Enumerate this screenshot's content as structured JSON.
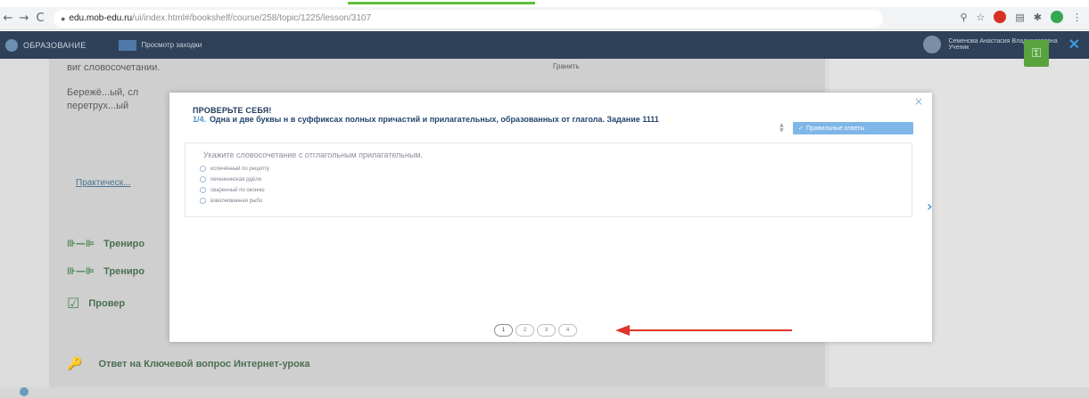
{
  "browser": {
    "back": "←",
    "forward": "→",
    "reload": "C",
    "url_host": "edu.mob-edu.ru",
    "url_path": "/ui/index.html#/bookshelf/course/258/topic/1225/lesson/3107",
    "icons": [
      "zoom-icon",
      "star-icon",
      "extension-red-icon",
      "extension-icon",
      "puzzle-icon",
      "extension-green-icon",
      "menu-icon"
    ]
  },
  "site": {
    "logo_text": "ОБРАЗОВАНИЕ",
    "nav_label": "Просмотр заходки",
    "user_name": "Семенова Анастасия Владиславовна",
    "user_sub": "Ученик",
    "close": "✕"
  },
  "background": {
    "line1": "виг словосочетании.",
    "line1_right": "Гранить",
    "line2": "Бережё...ый, сл",
    "line3": "перетрух...ый",
    "link": "Практическ...",
    "item1": "Трениро",
    "item2": "Трениро",
    "item3": "Провер",
    "key_question": "Ответ на Ключевой вопрос Интернет-урока"
  },
  "modal": {
    "close": "×",
    "title": "ПРОВЕРЬТЕ СЕБЯ!",
    "task_number": "1/4.",
    "task_text": "Одна и две буквы н в суффиксах полных причастий и прилагательных, образованных от глагола. Задание 1111",
    "correct_answers_label": "Правильные ответы",
    "question_prompt": "Укажите словосочетание с отглагольным прилагательным.",
    "options": [
      "испечённый по рецепту",
      "печеннинская рдёля",
      "сваренный по окончю",
      "взволнованная рыбо"
    ],
    "pages": [
      "1",
      "2",
      "3",
      "4"
    ],
    "active_page": 1
  },
  "colors": {
    "header": "#2f4159",
    "accent_blue": "#7fb6e8",
    "arrow_red": "#e0352b",
    "key_green": "#58a33d"
  }
}
